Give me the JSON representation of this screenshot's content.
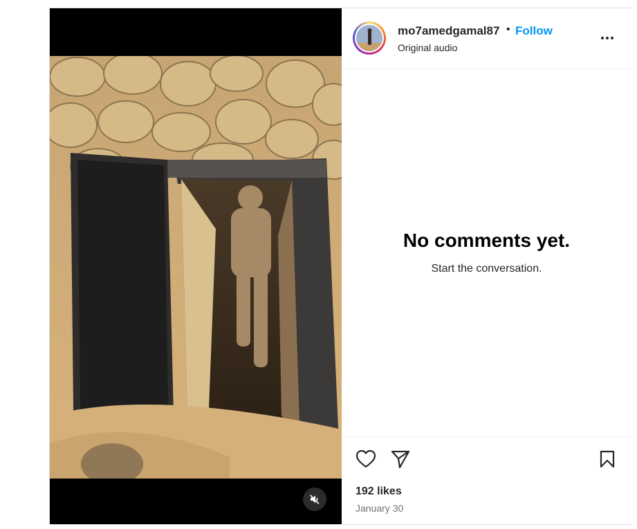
{
  "header": {
    "username": "mo7amedgamal87",
    "separator": "•",
    "follow_label": "Follow",
    "audio_label": "Original audio",
    "more_icon": "more-options-icon"
  },
  "comments": {
    "empty_title": "No comments yet.",
    "empty_subtitle": "Start the conversation."
  },
  "footer": {
    "likes": "192 likes",
    "date": "January 30"
  },
  "icons": {
    "like": "heart-icon",
    "share": "send-icon",
    "save": "bookmark-icon",
    "mute": "muted-speaker-icon"
  },
  "colors": {
    "follow": "#0095f6",
    "secondary_text": "#737373",
    "border": "#dbdbdb"
  }
}
